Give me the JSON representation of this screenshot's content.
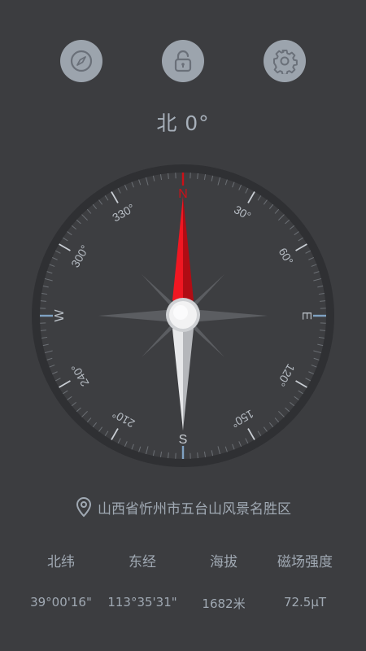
{
  "toolbar": {
    "compass_icon": "compass-icon",
    "lock_icon": "unlock-icon",
    "settings_icon": "gear-icon"
  },
  "heading": "北 0°",
  "dial": {
    "cardinals": {
      "n": "N",
      "e": "E",
      "s": "S",
      "w": "W"
    },
    "degree_labels": [
      "30°",
      "60°",
      "120°",
      "150°",
      "210°",
      "240°",
      "300°",
      "330°"
    ],
    "accent_color": "#cc1018"
  },
  "location": {
    "icon": "location-pin-icon",
    "text": "山西省忻州市五台山风景名胜区"
  },
  "stats": [
    {
      "label": "北纬",
      "value": "39°00'16\""
    },
    {
      "label": "东经",
      "value": "113°35'31\""
    },
    {
      "label": "海拔",
      "value": "1682米"
    },
    {
      "label": "磁场强度",
      "value": "72.5μT"
    }
  ]
}
